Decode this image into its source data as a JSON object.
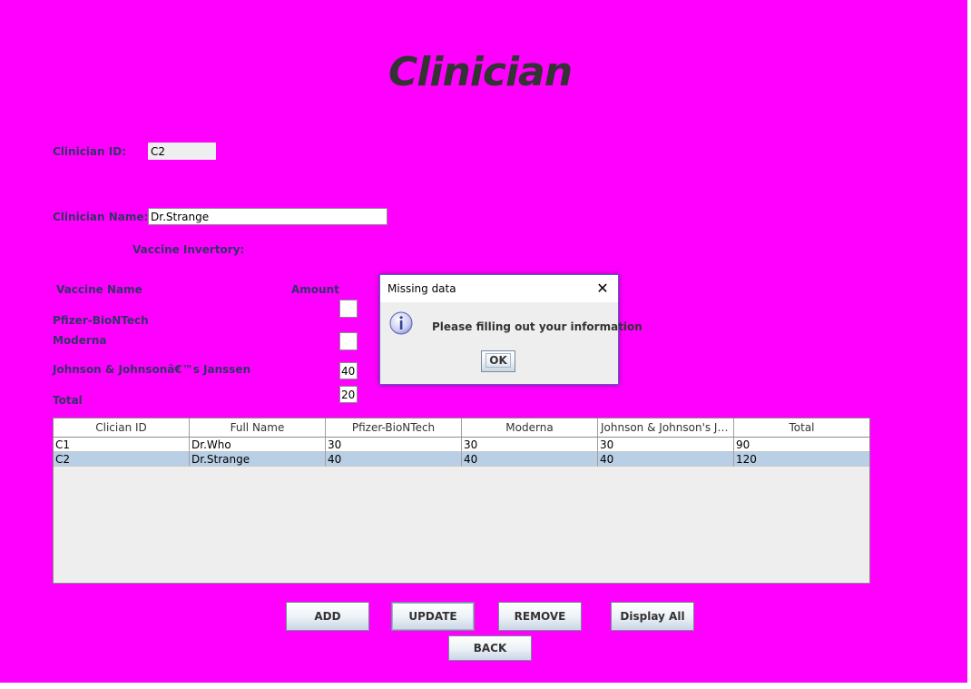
{
  "app": {
    "title": "Clinician"
  },
  "form": {
    "clinician_id_label": "Clinician ID:",
    "clinician_id_value": "C2",
    "clinician_name_label": "Clinician Name:",
    "clinician_name_value": "Dr.Strange",
    "inventory_label": "Vaccine Invertory:",
    "vaccine_name_header": "Vaccine Name",
    "amount_header": "Amount",
    "vaccines": [
      {
        "name": "Pfizer-BioNTech",
        "amount": ""
      },
      {
        "name": "Moderna",
        "amount": ""
      },
      {
        "name": "Johnson & Johnsonâ€™s Janssen",
        "amount": "40"
      }
    ],
    "total_label": "Total",
    "total_value": "20"
  },
  "table": {
    "columns": [
      "Clician ID",
      "Full Name",
      "Pfizer-BioNTech",
      "Moderna",
      "Johnson & Johnson's Ja...",
      "Total"
    ],
    "rows": [
      [
        "C1",
        "Dr.Who",
        "30",
        "30",
        "30",
        "90"
      ],
      [
        "C2",
        "Dr.Strange",
        "40",
        "40",
        "40",
        "120"
      ]
    ],
    "selected_row": 1
  },
  "buttons": {
    "add": "ADD",
    "update": "UPDATE",
    "remove": "REMOVE",
    "display_all": "Display All",
    "back": "BACK"
  },
  "dialog": {
    "title": "Missing data",
    "close_glyph": "✕",
    "message": "Please filling out your information",
    "ok": "OK",
    "icon": "info-icon"
  },
  "colors": {
    "background": "#ff00ff",
    "label": "#333366",
    "selected_row": "#b8cfe5"
  }
}
